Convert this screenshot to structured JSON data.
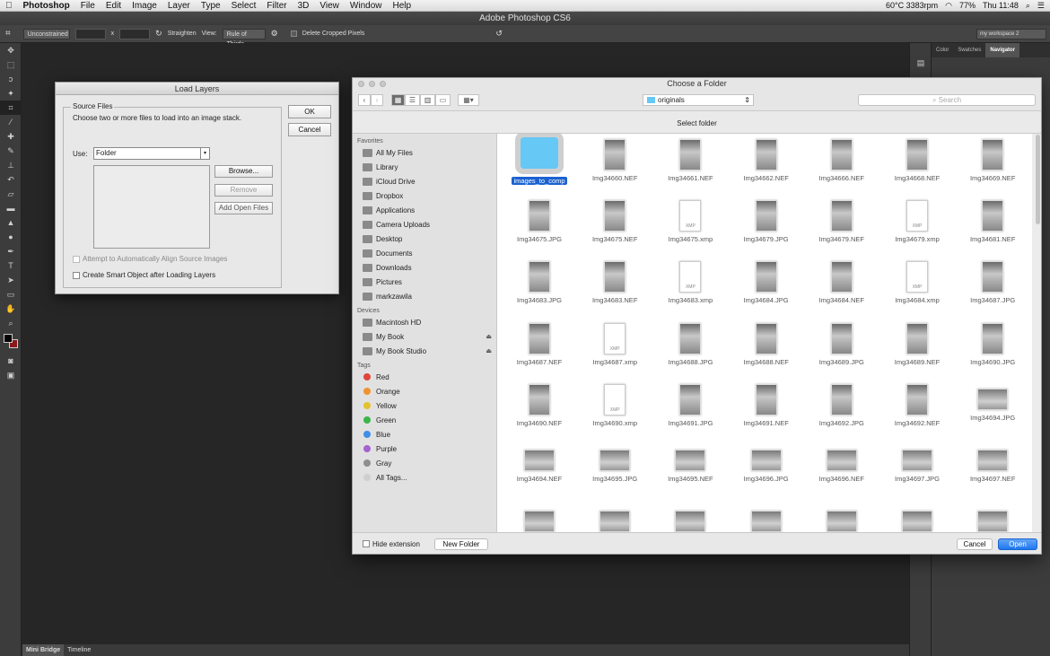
{
  "menubar": {
    "apple": "",
    "app": "Photoshop",
    "items": [
      "File",
      "Edit",
      "Image",
      "Layer",
      "Type",
      "Select",
      "Filter",
      "3D",
      "View",
      "Window",
      "Help"
    ],
    "status": {
      "temp": "60°C 3383rpm",
      "battery": "77%",
      "clock": "Thu 11:48"
    }
  },
  "title": "Adobe Photoshop CS6",
  "options": {
    "ratio": "Unconstrained",
    "x": "x",
    "straighten": "Straighten",
    "view_label": "View:",
    "view_value": "Rule of Thirds",
    "delete_pixels": "Delete Cropped Pixels",
    "workspace": "my workspace 2"
  },
  "right_panel": {
    "tabs": [
      "Color",
      "Swatches",
      "Navigator"
    ]
  },
  "bottom_tabs": [
    "Mini Bridge",
    "Timeline"
  ],
  "load_layers": {
    "title": "Load Layers",
    "group": "Source Files",
    "instructions": "Choose two or more files to load into an image stack.",
    "use_label": "Use:",
    "use_value": "Folder",
    "browse": "Browse...",
    "remove": "Remove",
    "add_open": "Add Open Files",
    "align": "Attempt to Automatically Align Source Images",
    "smart": "Create Smart Object after Loading Layers",
    "ok": "OK",
    "cancel": "Cancel"
  },
  "finder": {
    "title": "Choose a Folder",
    "location": "originals",
    "search_placeholder": "Search",
    "select_folder": "Select folder",
    "favorites_header": "Favorites",
    "favorites": [
      "All My Files",
      "Library",
      "iCloud Drive",
      "Dropbox",
      "Applications",
      "Camera Uploads",
      "Desktop",
      "Documents",
      "Downloads",
      "Pictures",
      "markzawila"
    ],
    "devices_header": "Devices",
    "devices": [
      "Macintosh HD",
      "My Book",
      "My Book Studio"
    ],
    "tags_header": "Tags",
    "tags": [
      {
        "name": "Red",
        "color": "#e0443b"
      },
      {
        "name": "Orange",
        "color": "#f0922e"
      },
      {
        "name": "Yellow",
        "color": "#e5c12c"
      },
      {
        "name": "Green",
        "color": "#3ab54a"
      },
      {
        "name": "Blue",
        "color": "#3f8ee8"
      },
      {
        "name": "Purple",
        "color": "#a463d0"
      },
      {
        "name": "Gray",
        "color": "#8e8e8e"
      },
      {
        "name": "All Tags...",
        "color": "#cfcfcf"
      }
    ],
    "files": [
      {
        "name": "images_to_comp",
        "kind": "folder"
      },
      {
        "name": "Img34660.NEF",
        "kind": "p"
      },
      {
        "name": "Img34661.NEF",
        "kind": "p"
      },
      {
        "name": "Img34662.NEF",
        "kind": "p"
      },
      {
        "name": "Img34666.NEF",
        "kind": "p"
      },
      {
        "name": "Img34668.NEF",
        "kind": "p"
      },
      {
        "name": "Img34669.NEF",
        "kind": "p"
      },
      {
        "name": "Img34675.JPG",
        "kind": "p"
      },
      {
        "name": "Img34675.NEF",
        "kind": "p"
      },
      {
        "name": "Img34675.xmp",
        "kind": "xmp"
      },
      {
        "name": "Img34679.JPG",
        "kind": "p"
      },
      {
        "name": "Img34679.NEF",
        "kind": "p"
      },
      {
        "name": "Img34679.xmp",
        "kind": "xmp"
      },
      {
        "name": "Img34681.NEF",
        "kind": "p"
      },
      {
        "name": "Img34683.JPG",
        "kind": "p"
      },
      {
        "name": "Img34683.NEF",
        "kind": "p"
      },
      {
        "name": "Img34683.xmp",
        "kind": "xmp"
      },
      {
        "name": "Img34684.JPG",
        "kind": "p"
      },
      {
        "name": "Img34684.NEF",
        "kind": "p"
      },
      {
        "name": "Img34684.xmp",
        "kind": "xmp"
      },
      {
        "name": "Img34687.JPG",
        "kind": "p"
      },
      {
        "name": "Img34687.NEF",
        "kind": "p"
      },
      {
        "name": "Img34687.xmp",
        "kind": "xmp"
      },
      {
        "name": "Img34688.JPG",
        "kind": "p"
      },
      {
        "name": "Img34688.NEF",
        "kind": "p"
      },
      {
        "name": "Img34689.JPG",
        "kind": "p"
      },
      {
        "name": "Img34689.NEF",
        "kind": "p"
      },
      {
        "name": "Img34690.JPG",
        "kind": "p"
      },
      {
        "name": "Img34690.NEF",
        "kind": "p"
      },
      {
        "name": "Img34690.xmp",
        "kind": "xmp"
      },
      {
        "name": "Img34691.JPG",
        "kind": "p"
      },
      {
        "name": "Img34691.NEF",
        "kind": "p"
      },
      {
        "name": "Img34692.JPG",
        "kind": "p"
      },
      {
        "name": "Img34692.NEF",
        "kind": "p"
      },
      {
        "name": "Img34694.JPG",
        "kind": "l"
      },
      {
        "name": "Img34694.NEF",
        "kind": "l"
      },
      {
        "name": "Img34695.JPG",
        "kind": "l"
      },
      {
        "name": "Img34695.NEF",
        "kind": "l"
      },
      {
        "name": "Img34696.JPG",
        "kind": "l"
      },
      {
        "name": "Img34696.NEF",
        "kind": "l"
      },
      {
        "name": "Img34697.JPG",
        "kind": "l"
      },
      {
        "name": "Img34697.NEF",
        "kind": "l"
      },
      {
        "name": "",
        "kind": "l"
      },
      {
        "name": "",
        "kind": "l"
      },
      {
        "name": "",
        "kind": "l"
      },
      {
        "name": "",
        "kind": "l"
      },
      {
        "name": "",
        "kind": "l"
      },
      {
        "name": "",
        "kind": "l"
      },
      {
        "name": "",
        "kind": "l"
      }
    ],
    "hide_extension": "Hide extension",
    "new_folder": "New Folder",
    "cancel": "Cancel",
    "open": "Open"
  }
}
